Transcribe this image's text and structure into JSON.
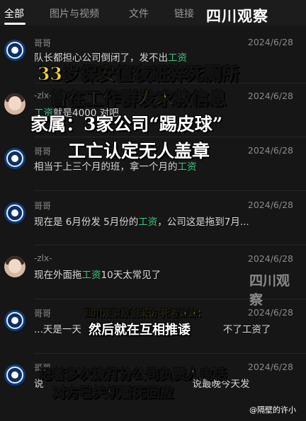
{
  "tabs": [
    "全部",
    "图片与视频",
    "文件",
    "链接"
  ],
  "brand": "四川观察",
  "watermark": "四川观察",
  "messages": [
    {
      "name": "哥哥",
      "date": "2024/6/28",
      "pre": "队长都担心公司倒闭了，发不出",
      "kw": "工资",
      "post": ""
    },
    {
      "name": "-zlx-",
      "date": "2024/6/28",
      "pre": "",
      "kw": "工资",
      "post": "就是4000 对吧"
    },
    {
      "name": "哥哥",
      "date": "2024/6/28",
      "pre": "相当于上三个月的班，拿一个月的",
      "kw": "工资",
      "post": ""
    },
    {
      "name": "哥哥",
      "date": "2024/6/28",
      "pre": "现在是 6月份发 5月份的",
      "kw": "工资",
      "post": "，公司这是拖到7月..."
    },
    {
      "name": "-zlx-",
      "date": "2024/6/28",
      "pre": "现在外面拖",
      "kw": "工资",
      "post": "10天太常见了"
    },
    {
      "name": "哥哥",
      "date": "2024/6/28",
      "pre": "...天是一天",
      "kw": "",
      "post": "不了工资了"
    },
    {
      "name": "哥哥",
      "date": "2024/6/28",
      "pre": "说",
      "kw": "",
      "post": "说最晚今天发"
    }
  ],
  "overlay": {
    "headline1": "33岁保安值夜班猝死厕所",
    "headline2": "曾在工作群发求救信息",
    "headline3": "家属：3家公司“踢皮球”",
    "headline4": "工亡认定无人盖章",
    "interview": "四川观察原创采访 死者妹妹：",
    "quote": "然后就在互相推诿",
    "bottom1": "记者多次拨打分公司负责人电话",
    "bottom2": "对方已关机暂无回应"
  },
  "footer": "@隔壁的许小"
}
